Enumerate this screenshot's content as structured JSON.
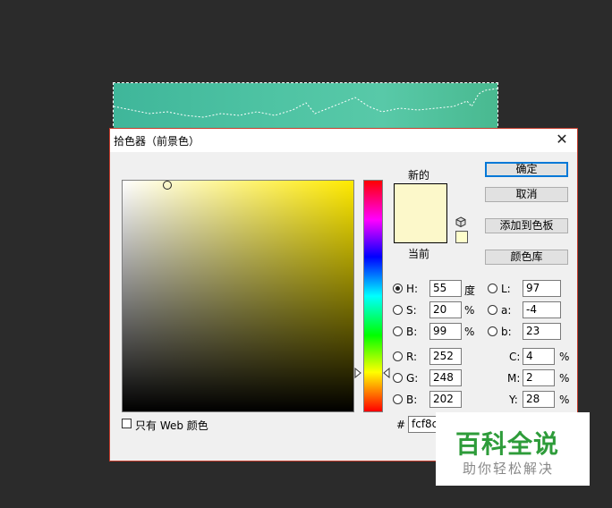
{
  "dialog": {
    "title": "拾色器（前景色）",
    "close_glyph": "✕"
  },
  "swatches": {
    "new_label": "新的",
    "current_label": "当前",
    "new_color": "#fcf8ca",
    "current_color": "#fcf8ca"
  },
  "buttons": {
    "ok": "确定",
    "cancel": "取消",
    "add_to_swatches": "添加到色板",
    "color_libraries": "颜色库"
  },
  "hsb": {
    "h_label": "H:",
    "h_value": "55",
    "h_unit": "度",
    "s_label": "S:",
    "s_value": "20",
    "s_unit": "%",
    "b_label": "B:",
    "b_value": "99",
    "b_unit": "%"
  },
  "rgb": {
    "r_label": "R:",
    "r_value": "252",
    "g_label": "G:",
    "g_value": "248",
    "b_label": "B:",
    "b_value": "202"
  },
  "lab": {
    "l_label": "L:",
    "l_value": "97",
    "a_label": "a:",
    "a_value": "-4",
    "b_label": "b:",
    "b_value": "23"
  },
  "cmyk": {
    "c_label": "C:",
    "c_value": "4",
    "c_unit": "%",
    "m_label": "M:",
    "m_value": "2",
    "m_unit": "%",
    "y_label": "Y:",
    "y_value": "28",
    "y_unit": "%"
  },
  "hex": {
    "label": "#",
    "value": "fcf8c"
  },
  "web_only": {
    "label": "只有 Web 颜色",
    "checked": false
  },
  "selected_mode": "H",
  "watermark": {
    "title": "百科全说",
    "subtitle": "助你轻松解决"
  },
  "icons": {
    "cube": "websafe-cube-icon",
    "close": "close-icon"
  }
}
